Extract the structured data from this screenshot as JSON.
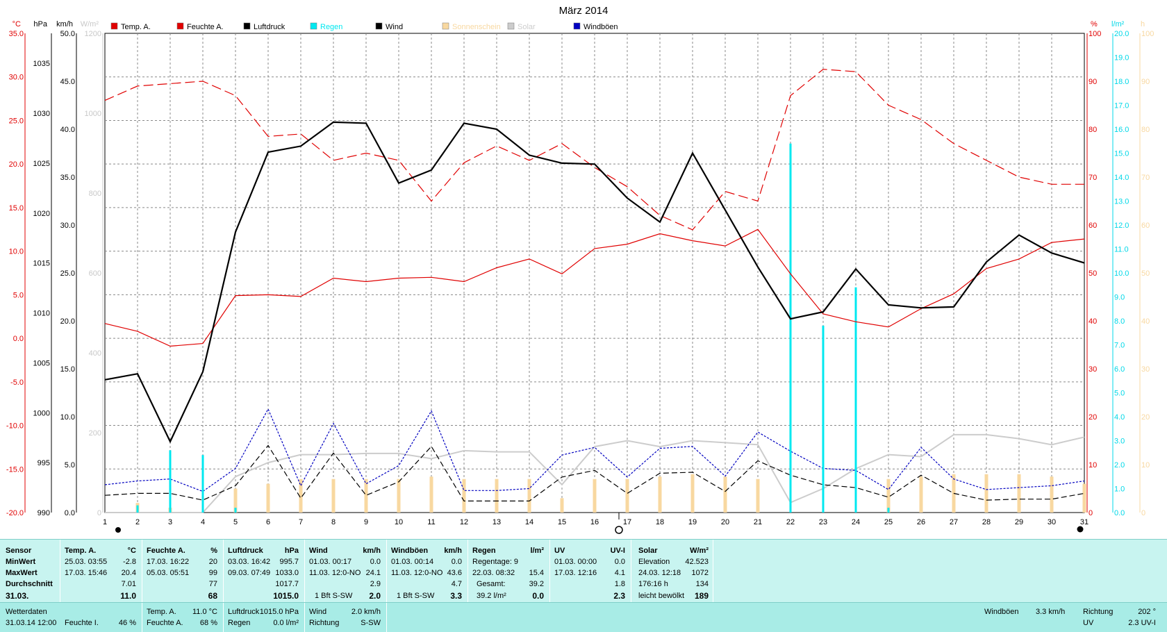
{
  "chart_data": {
    "type": "line",
    "title": "März 2014",
    "x": [
      1,
      2,
      3,
      4,
      5,
      6,
      7,
      8,
      9,
      10,
      11,
      12,
      13,
      14,
      15,
      16,
      17,
      18,
      19,
      20,
      21,
      22,
      23,
      24,
      25,
      26,
      27,
      28,
      29,
      30,
      31
    ],
    "axes": {
      "temp": {
        "unit": "°C",
        "range": [
          -20,
          35
        ],
        "ticks": [
          "35.0",
          "30.0",
          "25.0",
          "20.0",
          "15.0",
          "10.0",
          "5.0",
          "0.0",
          "-5.0",
          "-10.0",
          "-15.0",
          "-20.0"
        ]
      },
      "pressure": {
        "unit": "hPa",
        "range": [
          990,
          1038
        ],
        "ticks": [
          "1035",
          "1030",
          "1025",
          "1020",
          "1015",
          "1010",
          "1005",
          "1000",
          "995",
          "990"
        ]
      },
      "wind": {
        "unit": "km/h",
        "range": [
          0,
          50
        ],
        "ticks": [
          "50.0",
          "45.0",
          "40.0",
          "35.0",
          "30.0",
          "25.0",
          "20.0",
          "15.0",
          "10.0",
          "5.0",
          "0.0"
        ]
      },
      "solar": {
        "unit": "W/m²",
        "range": [
          0,
          1200
        ],
        "ticks": [
          "1200",
          "1000",
          "800",
          "600",
          "400",
          "200",
          "0"
        ]
      },
      "humidity": {
        "unit": "%",
        "range": [
          0,
          100
        ],
        "ticks": [
          "100",
          "90",
          "80",
          "70",
          "60",
          "50",
          "40",
          "30",
          "20",
          "10",
          "0"
        ]
      },
      "rain": {
        "unit": "l/m²",
        "range": [
          0,
          20
        ],
        "ticks": [
          "20.0",
          "19.0",
          "18.0",
          "17.0",
          "16.0",
          "15.0",
          "14.0",
          "13.0",
          "12.0",
          "11.0",
          "10.0",
          "9.0",
          "8.0",
          "7.0",
          "6.0",
          "5.0",
          "4.0",
          "3.0",
          "2.0",
          "1.0",
          "0.0"
        ]
      },
      "sun": {
        "unit": "h",
        "range": [
          0,
          100
        ],
        "ticks": [
          "100",
          "90",
          "80",
          "70",
          "60",
          "50",
          "40",
          "30",
          "20",
          "10",
          "0"
        ]
      }
    },
    "legend": [
      {
        "name": "Temp. A.",
        "color": "#e00000"
      },
      {
        "name": "Feuchte A.",
        "color": "#e00000"
      },
      {
        "name": "Luftdruck",
        "color": "#000000"
      },
      {
        "name": "Regen",
        "color": "#00e8f0"
      },
      {
        "name": "Wind",
        "color": "#000000"
      },
      {
        "name": "Sonnenschein",
        "color": "#f8d8a0"
      },
      {
        "name": "Solar",
        "color": "#cccccc"
      },
      {
        "name": "Windböen",
        "color": "#0000c0"
      }
    ],
    "series": [
      {
        "name": "Temp. A.",
        "axis": "temp",
        "color": "#e00000",
        "style": "solid",
        "values": [
          1.7,
          0.8,
          -0.9,
          -0.6,
          4.9,
          5.0,
          4.8,
          6.9,
          6.5,
          6.9,
          7.0,
          6.5,
          8.1,
          9.1,
          7.4,
          10.3,
          10.8,
          12.0,
          11.2,
          10.6,
          12.5,
          7.4,
          2.8,
          1.9,
          1.3,
          3.4,
          5.1,
          8.0,
          9.1,
          11.0,
          11.4
        ]
      },
      {
        "name": "Feuchte A.",
        "axis": "humidity",
        "color": "#e00000",
        "style": "dashed",
        "values": [
          86,
          89,
          89.5,
          90,
          87,
          78.5,
          79,
          73.5,
          75,
          73.5,
          65,
          73,
          76.5,
          73.5,
          77,
          72,
          68,
          62,
          59,
          67,
          65,
          87,
          92.5,
          92,
          85,
          82,
          77,
          73.5,
          70,
          68.5,
          68.5
        ]
      },
      {
        "name": "Luftdruck",
        "axis": "pressure",
        "color": "#000000",
        "style": "solid",
        "values": [
          1003.3,
          1003.9,
          997.1,
          1004.1,
          1018.1,
          1026.1,
          1026.7,
          1029.1,
          1029.0,
          1023.0,
          1024.3,
          1029.0,
          1028.4,
          1025.8,
          1025.0,
          1024.9,
          1021.5,
          1019.1,
          1026.0,
          1020.3,
          1014.6,
          1009.4,
          1010.1,
          1014.4,
          1010.8,
          1010.5,
          1010.6,
          1015.1,
          1017.8,
          1016.0,
          1015.0
        ]
      },
      {
        "name": "Wind",
        "axis": "wind",
        "color": "#000000",
        "style": "dashed",
        "values": [
          1.8,
          2.0,
          2.0,
          1.3,
          2.8,
          7.0,
          1.5,
          6.2,
          1.8,
          3.2,
          6.9,
          1.2,
          1.2,
          1.2,
          3.7,
          4.4,
          2.0,
          4.1,
          4.2,
          2.2,
          5.4,
          3.9,
          2.9,
          2.6,
          1.6,
          3.9,
          2.0,
          1.3,
          1.4,
          1.4,
          2.0
        ]
      },
      {
        "name": "Windböen",
        "axis": "wind",
        "color": "#0000c0",
        "style": "dotted",
        "values": [
          2.9,
          3.3,
          3.5,
          2.2,
          4.6,
          10.8,
          2.8,
          9.3,
          3.0,
          4.9,
          10.6,
          2.3,
          2.3,
          2.5,
          6.0,
          6.8,
          3.7,
          6.7,
          6.9,
          3.8,
          8.4,
          6.4,
          4.6,
          4.4,
          2.4,
          6.8,
          3.5,
          2.4,
          2.6,
          2.8,
          3.3
        ]
      },
      {
        "name": "Solar",
        "axis": "solar",
        "color": "#cccccc",
        "style": "solid",
        "values": [
          0,
          0,
          0,
          0,
          90,
          125,
          145,
          145,
          148,
          148,
          135,
          155,
          152,
          152,
          70,
          165,
          180,
          165,
          180,
          175,
          170,
          25,
          60,
          110,
          145,
          140,
          195,
          195,
          185,
          170,
          189
        ]
      },
      {
        "name": "Regen",
        "axis": "rain",
        "color": "#00e8f0",
        "style": "bars",
        "values": [
          0,
          0.3,
          2.6,
          2.4,
          0.2,
          0,
          0,
          0,
          0,
          0,
          0,
          0,
          0,
          0,
          0,
          0,
          0,
          0,
          0,
          0,
          0,
          15.4,
          7.8,
          9.4,
          0.2,
          0,
          0,
          0,
          0,
          0,
          0
        ]
      },
      {
        "name": "Sonnenschein",
        "axis": "sun",
        "color": "#f8d8a0",
        "style": "bars",
        "values": [
          0,
          2,
          1,
          0,
          5,
          6,
          7,
          7,
          7,
          7,
          7.5,
          7,
          7,
          7,
          3,
          7,
          7,
          7.5,
          8,
          7.5,
          7,
          0,
          0,
          0,
          7,
          7.5,
          8,
          8,
          8,
          7.5,
          6
        ]
      }
    ]
  },
  "stats": {
    "headers": {
      "sensor": "Sensor",
      "temp": "Temp. A.",
      "temp_unit": "°C",
      "hum": "Feuchte A.",
      "hum_unit": "%",
      "press": "Luftdruck",
      "press_unit": "hPa",
      "wind": "Wind",
      "wind_unit": "km/h",
      "gust": "Windböen",
      "gust_unit": "km/h",
      "rain": "Regen",
      "rain_unit": "l/m²",
      "uv": "UV",
      "uv_unit": "UV-I",
      "solar": "Solar",
      "solar_unit": "W/m²"
    },
    "rows": {
      "min": "MinWert",
      "max": "MaxWert",
      "avg": "Durchschnitt",
      "date": "31.03."
    },
    "temp": {
      "min_t": "25.03.  03:55",
      "min_v": "-2.8",
      "max_t": "17.03.  15:46",
      "max_v": "20.4",
      "avg": "7.01",
      "cur": "11.0"
    },
    "hum": {
      "min_t": "17.03.  16:22",
      "min_v": "20",
      "max_t": "05.03.  05:51",
      "max_v": "99",
      "avg": "77",
      "cur": "68"
    },
    "press": {
      "min_t": "03.03.  16:42",
      "min_v": "995.7",
      "max_t": "09.03.  07:49",
      "max_v": "1033.0",
      "avg": "1017.7",
      "cur": "1015.0"
    },
    "wind": {
      "min_t": "01.03.  00:17",
      "min_v": "0.0",
      "max_t": "11.03.  12:0-NO",
      "max_v": "24.1",
      "avg": "2.9",
      "cur_l": "1 Bft S-SW",
      "cur": "2.0"
    },
    "gust": {
      "min_t": "01.03.  00:14",
      "min_v": "0.0",
      "max_t": "11.03.  12:0-NO",
      "max_v": "43.6",
      "avg": "4.7",
      "cur_l": "1 Bft S-SW",
      "cur": "3.3"
    },
    "rain": {
      "r1_l": "Regentage: 9",
      "r2_l": "22.03.  08:32",
      "r2_v": "15.4",
      "r3_l": "Gesamt:",
      "r3_v": "39.2",
      "r4_l": "39.2 l/m²",
      "cur": "0.0"
    },
    "uv": {
      "min_t": "01.03.  00:00",
      "min_v": "0.0",
      "max_t": "17.03.  12:16",
      "max_v": "4.1",
      "avg": "1.8",
      "cur": "2.3"
    },
    "solar": {
      "r1_l": "Elevation",
      "r1_v": "42.523",
      "r2_l": "24.03.  12:18",
      "r2_v": "1072",
      "r3_l": "176:16 h",
      "r3_v": "134",
      "r4_l": "leicht bewölkt",
      "cur": "189"
    }
  },
  "current": {
    "label1": "Wetterdaten",
    "label2": "31.03.14 12:00",
    "fi_l": "Feuchte I.",
    "fi_v": "46 %",
    "ta_l": "Temp. A.",
    "ta_v": "11.0 °C",
    "fa_l": "Feuchte A.",
    "fa_v": "68 %",
    "lp_l": "Luftdruck",
    "lp_v": "1015.0 hPa",
    "rg_l": "Regen",
    "rg_v": "0.0 l/m²",
    "wd_l": "Wind",
    "wd_v": "2.0 km/h",
    "ri_l": "Richtung",
    "ri_v": "S-SW",
    "wb_l": "Windböen",
    "wb_v": "3.3 km/h",
    "r2_l": "Richtung",
    "r2_v": "202 °",
    "uv_l": "UV",
    "uv_v": "2.3 UV-I"
  }
}
